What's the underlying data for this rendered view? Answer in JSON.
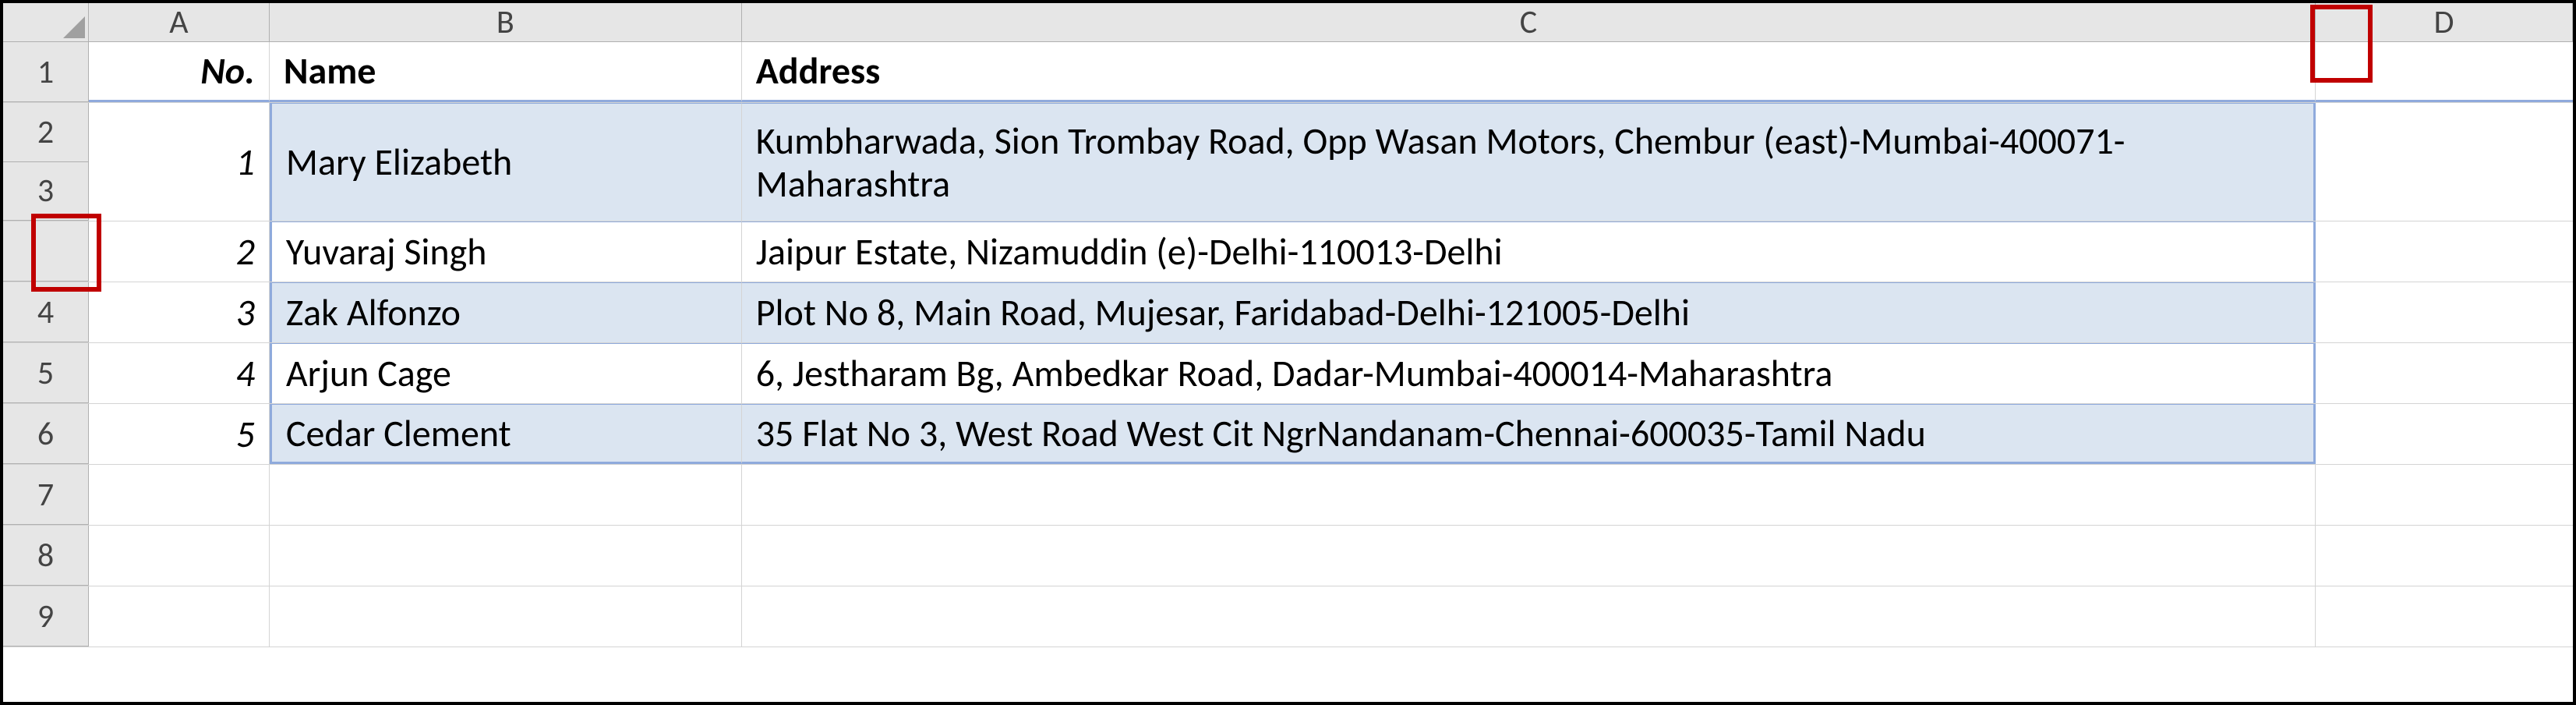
{
  "columns": {
    "A": "A",
    "B": "B",
    "C": "C",
    "D": "D"
  },
  "row_numbers": [
    "1",
    "2",
    "3",
    "4",
    "5",
    "6",
    "7",
    "8",
    "9"
  ],
  "header": {
    "no": "No.",
    "name": "Name",
    "address": "Address"
  },
  "rows": [
    {
      "no": "1",
      "name": "Mary Elizabeth",
      "address": "Kumbharwada, Sion Trombay Road, Opp Wasan Motors, Chembur (east)-Mumbai-400071-Maharashtra"
    },
    {
      "no": "2",
      "name": "Yuvaraj Singh",
      "address": "Jaipur Estate, Nizamuddin (e)-Delhi-110013-Delhi"
    },
    {
      "no": "3",
      "name": "Zak Alfonzo",
      "address": "Plot No 8, Main Road, Mujesar, Faridabad-Delhi-121005-Delhi"
    },
    {
      "no": "4",
      "name": "Arjun Cage",
      "address": "6, Jestharam Bg, Ambedkar Road, Dadar-Mumbai-400014-Maharashtra"
    },
    {
      "no": "5",
      "name": "Cedar Clement",
      "address": "35 Flat No 3, West Road West Cit NgrNandanam-Chennai-600035-Tamil Nadu"
    }
  ]
}
